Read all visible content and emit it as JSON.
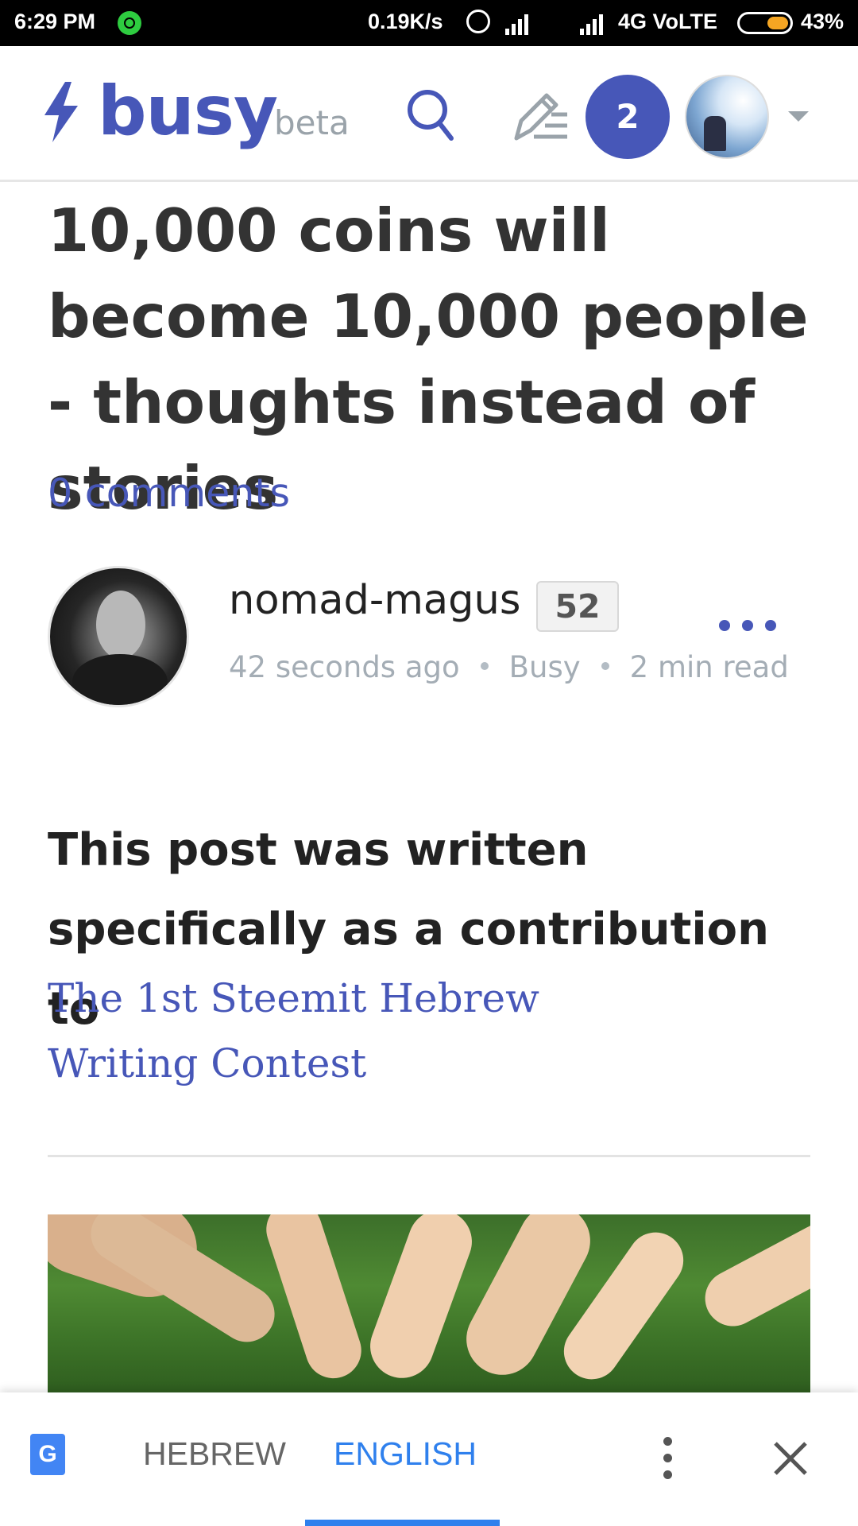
{
  "status_bar": {
    "time": "6:29 PM",
    "speed": "0.19K/s",
    "network": "4G VoLTE",
    "battery": "43%"
  },
  "header": {
    "logo": "busy",
    "beta": "beta",
    "notifications": "2",
    "accent": "#4757b8"
  },
  "post": {
    "title": "10,000 coins will become 10,000 people - thoughts instead of stories",
    "comments": "0 comments",
    "author": {
      "name": "nomad-magus",
      "reputation": "52",
      "time": "42 seconds ago",
      "app": "Busy",
      "read_time": "2 min read"
    },
    "lead": "This post was written specifically as a contribution to",
    "link": "The 1st Steemit Hebrew Writing Contest"
  },
  "translate_bar": {
    "source_lang": "HEBREW",
    "target_lang": "ENGLISH",
    "icon_letter": "G",
    "icon_glyph": "文"
  }
}
